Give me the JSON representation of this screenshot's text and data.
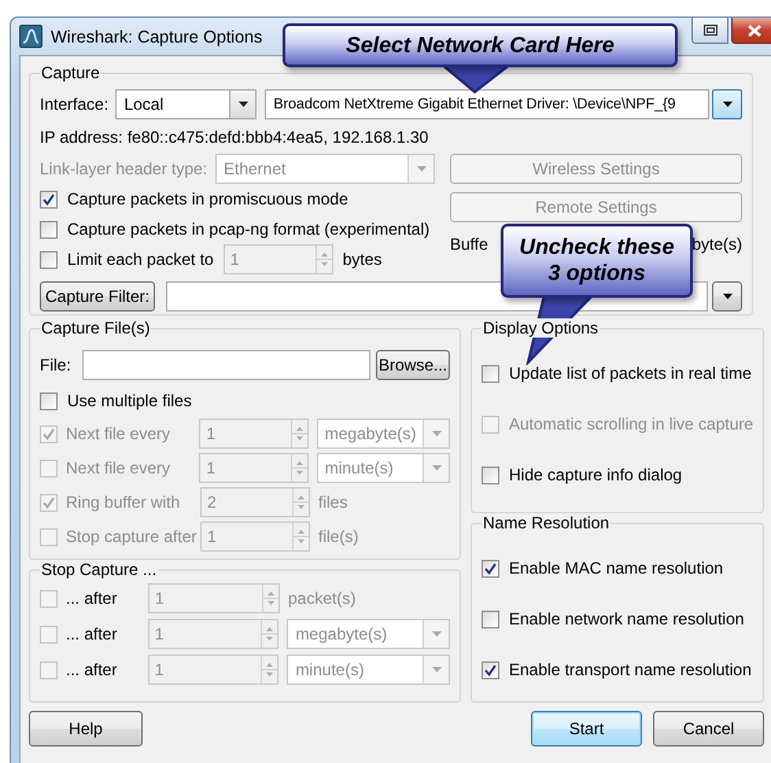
{
  "window": {
    "title": "Wireshark: Capture Options"
  },
  "capture": {
    "title": "Capture",
    "interface": {
      "label": "Interface:",
      "type": "Local",
      "device": "Broadcom NetXtreme Gigabit Ethernet Driver: \\Device\\NPF_{9"
    },
    "ip_address": "IP address: fe80::c475:defd:bbb4:4ea5, 192.168.1.30",
    "link_layer": {
      "label": "Link-layer header type:",
      "value": "Ethernet",
      "disabled": true
    },
    "options": [
      {
        "kind": "plain",
        "label": "Capture packets in promiscuous mode",
        "checked": true
      },
      {
        "kind": "plain",
        "label": "Capture packets in pcap-ng format (experimental)",
        "checked": false
      },
      {
        "kind": "spin",
        "label": "Limit each packet to",
        "checked": false,
        "value": "1",
        "unit": "bytes"
      }
    ],
    "buttons": [
      {
        "label": "Wireless Settings",
        "disabled": true
      },
      {
        "label": "Remote Settings",
        "disabled": true
      }
    ],
    "buffer_label_parts": [
      "Buffe",
      "byte(s)"
    ],
    "filter_button": "Capture Filter:"
  },
  "capture_files": {
    "title": "Capture File(s)",
    "file_label": "File:",
    "browse_button": "Browse...",
    "multiple": {
      "label": "Use multiple files",
      "checked": false
    },
    "rows": [
      {
        "kind": "dropdown",
        "label": "Next file every",
        "checked": true,
        "disabled": true,
        "value": "1",
        "unit": "megabyte(s)"
      },
      {
        "kind": "dropdown",
        "label": "Next file every",
        "checked": false,
        "disabled": true,
        "value": "1",
        "unit": "minute(s)"
      },
      {
        "kind": "text",
        "label": "Ring buffer with",
        "checked": true,
        "disabled": true,
        "value": "2",
        "unit": "files"
      },
      {
        "kind": "text",
        "label": "Stop capture after",
        "checked": false,
        "disabled": true,
        "value": "1",
        "unit": "file(s)"
      }
    ]
  },
  "stop_capture": {
    "title": "Stop Capture ...",
    "rows": [
      {
        "kind": "text",
        "label": "... after",
        "checked": false,
        "disabled": false,
        "value": "1",
        "unit": "packet(s)"
      },
      {
        "kind": "dropdown",
        "label": "... after",
        "checked": false,
        "disabled": false,
        "value": "1",
        "unit": "megabyte(s)"
      },
      {
        "kind": "dropdown",
        "label": "... after",
        "checked": false,
        "disabled": false,
        "value": "1",
        "unit": "minute(s)"
      }
    ]
  },
  "display_options": {
    "title": "Display Options",
    "options": [
      {
        "label": "Update list of packets in real time",
        "checked": false,
        "disabled": false
      },
      {
        "label": "Automatic scrolling in live capture",
        "checked": false,
        "disabled": true
      },
      {
        "label": "Hide capture info dialog",
        "checked": false,
        "disabled": false
      }
    ]
  },
  "name_resolution": {
    "title": "Name Resolution",
    "options": [
      {
        "label": "Enable MAC name resolution",
        "checked": true,
        "disabled": false
      },
      {
        "label": "Enable network name resolution",
        "checked": false,
        "disabled": false
      },
      {
        "label": "Enable transport name resolution",
        "checked": true,
        "disabled": false
      }
    ]
  },
  "buttons": [
    {
      "label": "Help",
      "focused": false
    },
    {
      "label": "Start",
      "focused": true
    },
    {
      "label": "Cancel",
      "focused": false
    }
  ],
  "callouts": [
    {
      "text": "Select Network Card Here"
    },
    {
      "text": "Uncheck these\n3 options"
    }
  ]
}
